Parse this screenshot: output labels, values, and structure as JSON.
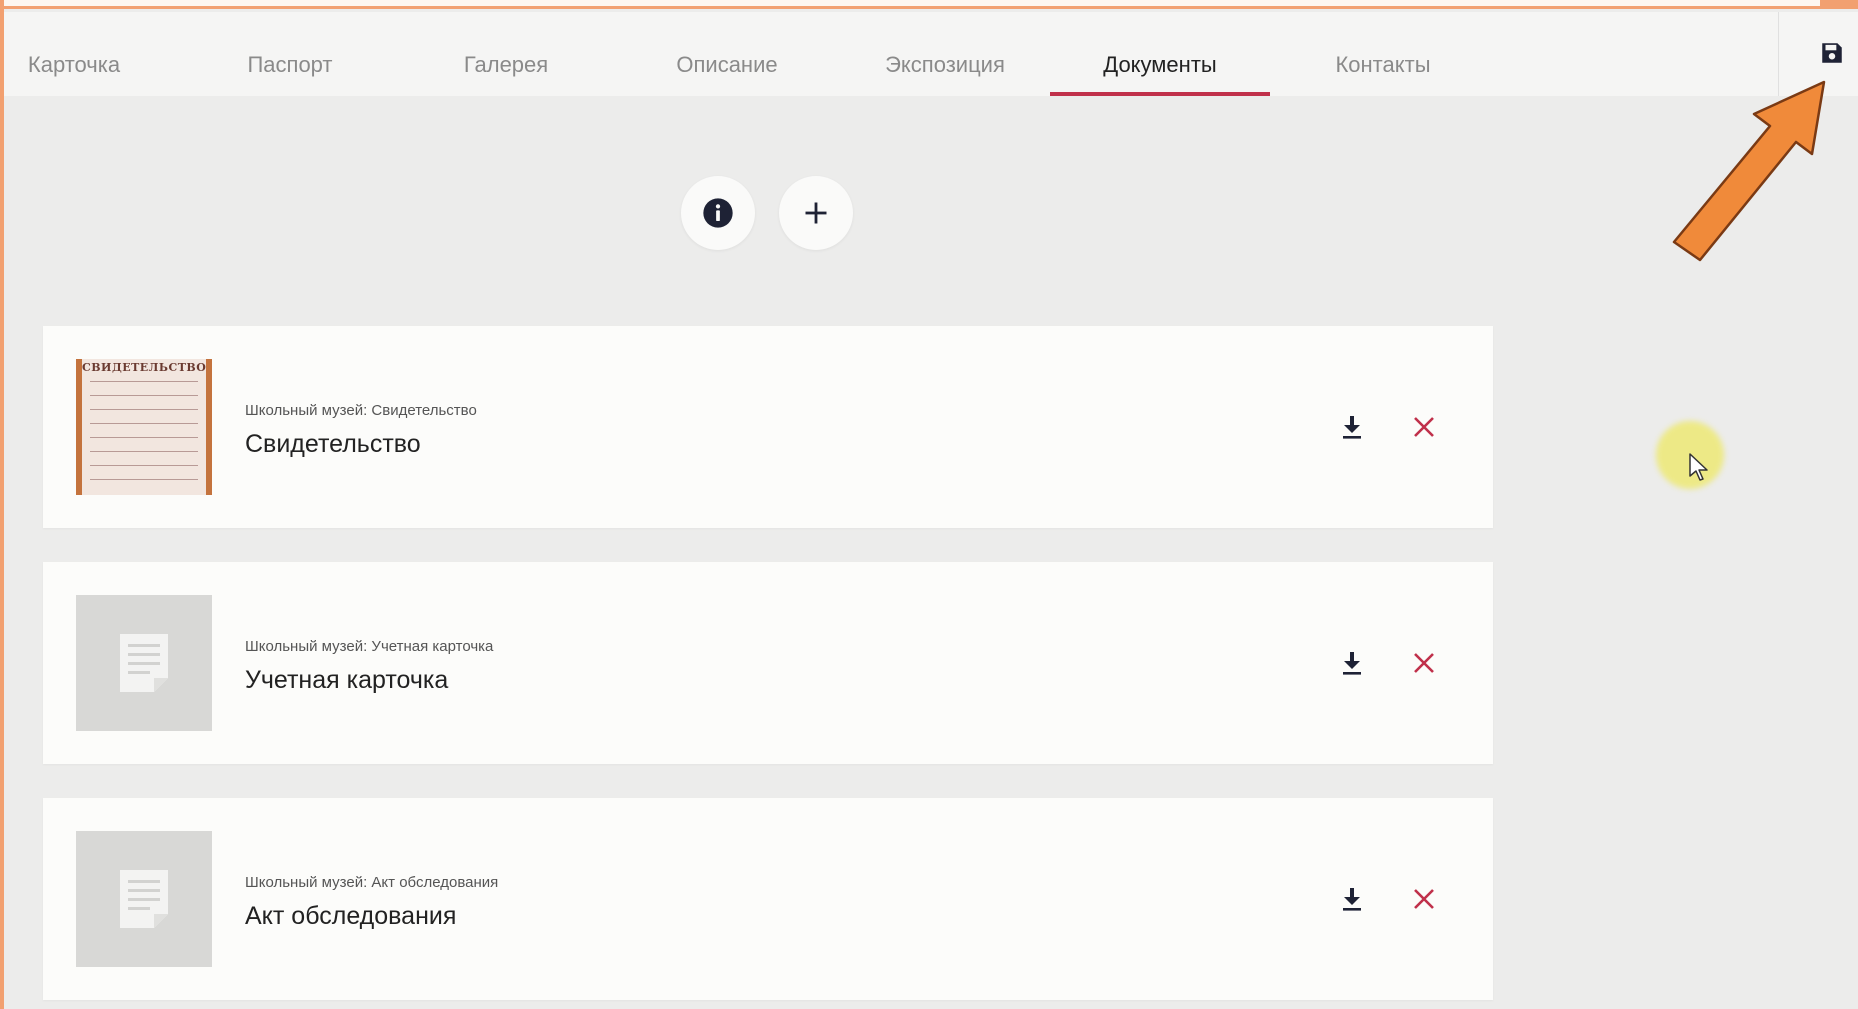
{
  "tabs": [
    {
      "label": "Карточка"
    },
    {
      "label": "Паспорт"
    },
    {
      "label": "Галерея"
    },
    {
      "label": "Описание"
    },
    {
      "label": "Экспозиция"
    },
    {
      "label": "Документы",
      "active": true
    },
    {
      "label": "Контакты"
    }
  ],
  "toolbar": {
    "info_icon": "info-icon",
    "add_icon": "plus-icon",
    "save_icon": "floppy-disk-icon"
  },
  "certificate_thumb_text": "СВИДЕТЕЛЬСТВО",
  "documents": [
    {
      "subtitle": "Школьный музей: Свидетельство",
      "title": "Свидетельство",
      "thumb": "certificate"
    },
    {
      "subtitle": "Школьный музей: Учетная карточка",
      "title": "Учетная карточка",
      "thumb": "file-icon"
    },
    {
      "subtitle": "Школьный музей: Акт обследования",
      "title": "Акт обследования",
      "thumb": "file-icon"
    }
  ],
  "colors": {
    "accent": "#c0304a",
    "frame": "#f2a070",
    "arrow": "#f08a3a",
    "icon_dark": "#1e2235"
  }
}
